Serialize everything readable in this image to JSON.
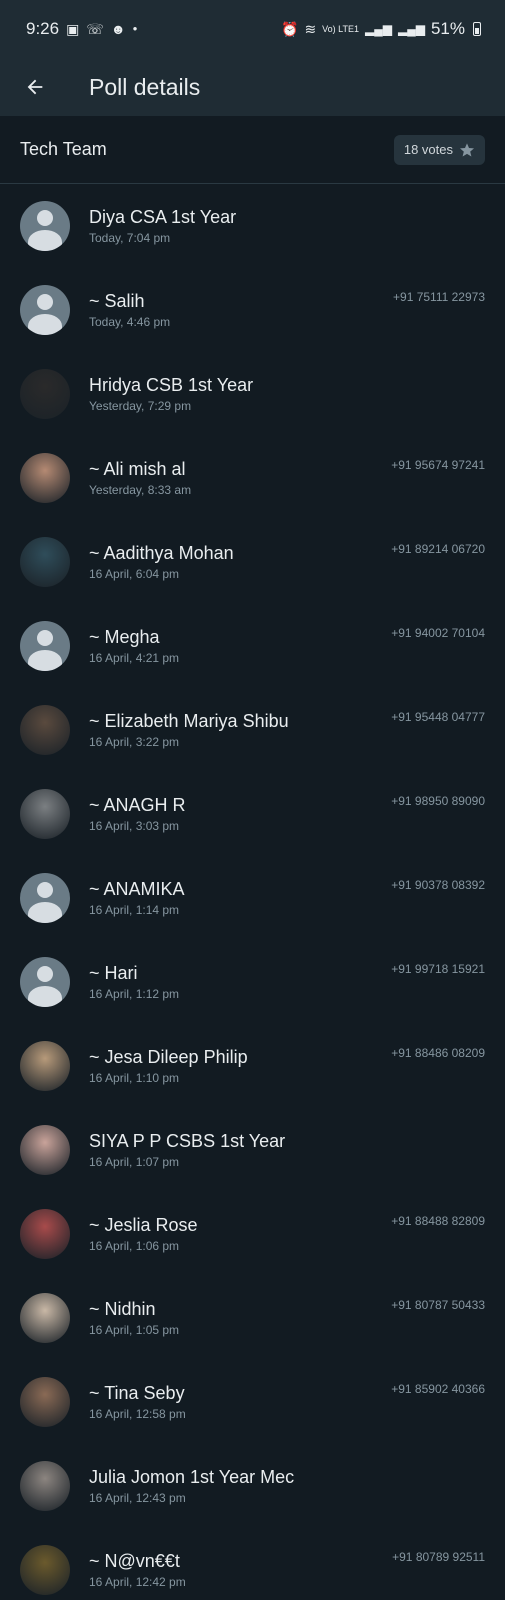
{
  "status_bar": {
    "time": "9:26",
    "battery": "51%",
    "net_label": "Vo) LTE1"
  },
  "header": {
    "title": "Poll details"
  },
  "option": {
    "name": "Tech Team",
    "votes": "18 votes"
  },
  "voters": [
    {
      "name": "Diya CSA 1st Year",
      "time": "Today, 7:04 pm",
      "phone": "",
      "avatar": "default"
    },
    {
      "name": "~ Salih",
      "time": "Today, 4:46 pm",
      "phone": "+91 75111 22973",
      "avatar": "default"
    },
    {
      "name": "Hridya CSB 1st Year",
      "time": "Yesterday, 7:29 pm",
      "phone": "",
      "avatar": "#2a2a2a"
    },
    {
      "name": "~ Ali mish al",
      "time": "Yesterday, 8:33 am",
      "phone": "+91 95674 97241",
      "avatar": "#b58a73"
    },
    {
      "name": "~ Aadithya Mohan",
      "time": "16 April, 6:04 pm",
      "phone": "+91 89214 06720",
      "avatar": "#2f4d5a"
    },
    {
      "name": "~ Megha",
      "time": "16 April, 4:21 pm",
      "phone": "+91 94002 70104",
      "avatar": "default"
    },
    {
      "name": "~ Elizabeth Mariya Shibu",
      "time": "16 April, 3:22 pm",
      "phone": "+91 95448 04777",
      "avatar": "#5a4a3e"
    },
    {
      "name": "~ ANAGH R",
      "time": "16 April, 3:03 pm",
      "phone": "+91 98950 89090",
      "avatar": "#7b7f82"
    },
    {
      "name": "~ ANAMIKA",
      "time": "16 April, 1:14 pm",
      "phone": "+91 90378 08392",
      "avatar": "default"
    },
    {
      "name": "~ Hari",
      "time": "16 April, 1:12 pm",
      "phone": "+91 99718 15921",
      "avatar": "default"
    },
    {
      "name": "~ Jesa Dileep Philip",
      "time": "16 April, 1:10 pm",
      "phone": "+91 88486 08209",
      "avatar": "#b79a7a"
    },
    {
      "name": "SIYA P P CSBS 1st Year",
      "time": "16 April, 1:07 pm",
      "phone": "",
      "avatar": "#c9a39a"
    },
    {
      "name": "~ Jeslia Rose",
      "time": "16 April, 1:06 pm",
      "phone": "+91 88488 82809",
      "avatar": "#a84b4b"
    },
    {
      "name": "~ Nidhin",
      "time": "16 April, 1:05 pm",
      "phone": "+91 80787 50433",
      "avatar": "#c9b8a6"
    },
    {
      "name": "~ Tina Seby",
      "time": "16 April, 12:58 pm",
      "phone": "+91 85902 40366",
      "avatar": "#8a6a55"
    },
    {
      "name": "Julia Jomon 1st Year Mec",
      "time": "16 April, 12:43 pm",
      "phone": "",
      "avatar": "#8c8580"
    },
    {
      "name": "~ N@vn€€t",
      "time": "16 April, 12:42 pm",
      "phone": "+91 80789 92511",
      "avatar": "#6b5a2c"
    }
  ]
}
